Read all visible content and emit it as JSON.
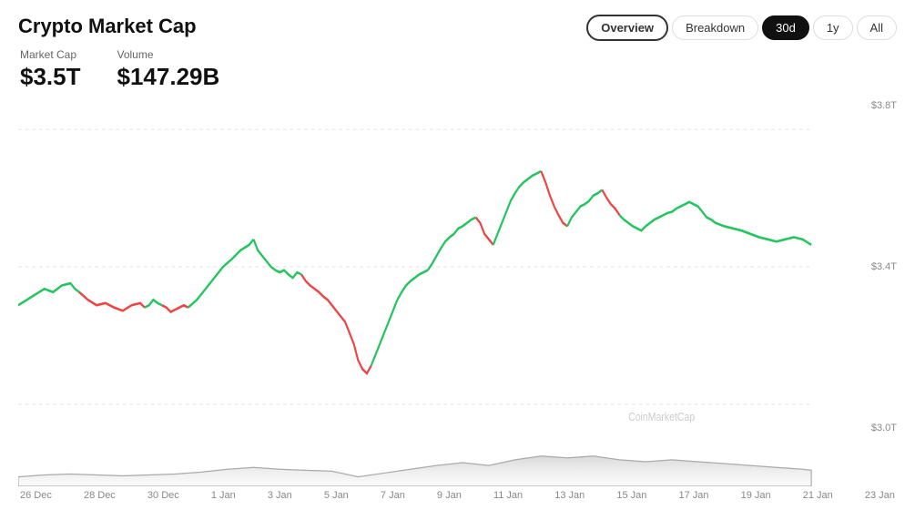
{
  "header": {
    "title": "Crypto Market Cap",
    "tabs": [
      {
        "label": "Overview",
        "active": true,
        "type": "view"
      },
      {
        "label": "Breakdown",
        "active": false,
        "type": "view"
      },
      {
        "label": "30d",
        "active": true,
        "type": "time"
      },
      {
        "label": "1y",
        "active": false,
        "type": "time"
      },
      {
        "label": "All",
        "active": false,
        "type": "time"
      }
    ]
  },
  "metrics": {
    "market_cap_label": "Market Cap",
    "market_cap_value": "$3.5T",
    "volume_label": "Volume",
    "volume_value": "$147.29B"
  },
  "chart": {
    "y_labels": [
      "$3.8T",
      "$3.4T",
      "$3.0T"
    ],
    "x_labels": [
      "26 Dec",
      "28 Dec",
      "30 Dec",
      "1 Jan",
      "3 Jan",
      "5 Jan",
      "7 Jan",
      "9 Jan",
      "11 Jan",
      "13 Jan",
      "15 Jan",
      "17 Jan",
      "19 Jan",
      "21 Jan",
      "23 Jan"
    ]
  },
  "watermark": "CoinMarketCap"
}
